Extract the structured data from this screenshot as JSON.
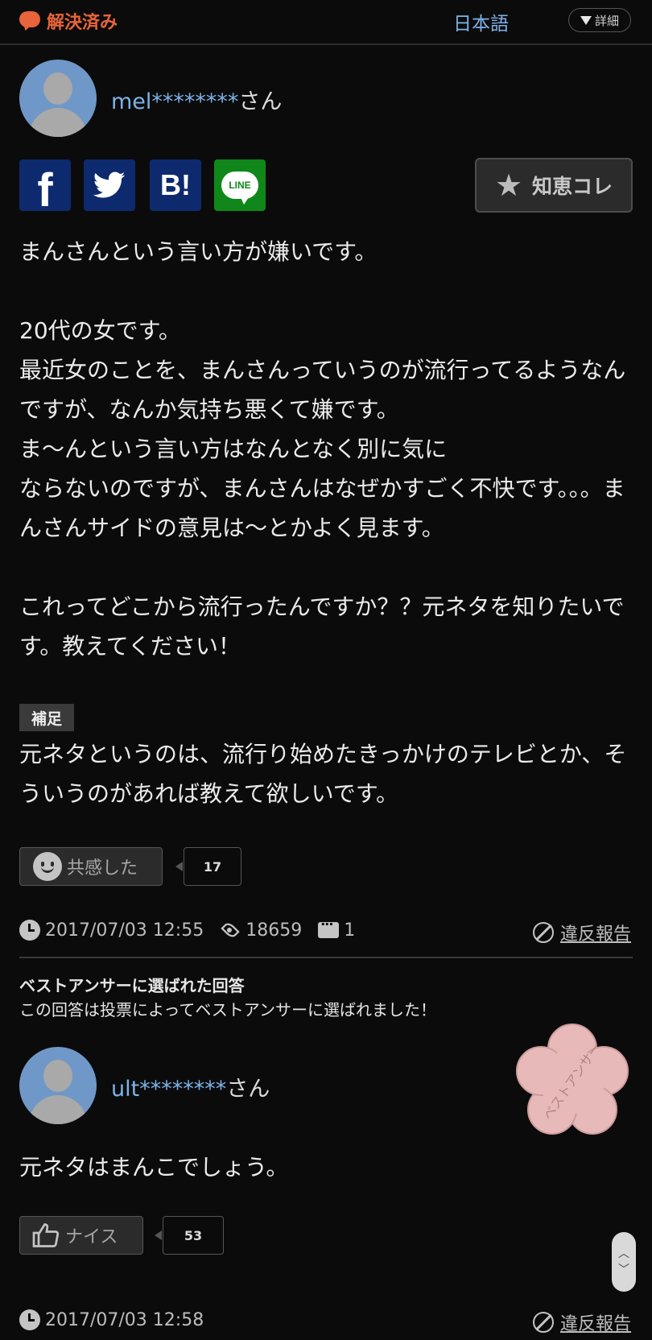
{
  "header": {
    "status": "解決済み",
    "language": "日本語",
    "details_label": "詳細"
  },
  "question": {
    "user_name": "mel********",
    "user_suffix": "さん",
    "share": {
      "facebook": "f",
      "twitter": "twitter-bird-icon",
      "hatena": "B!",
      "line": "LINE"
    },
    "chie_collection_label": "知恵コレ",
    "body": "まんさんという言い方が嫌いです。\n\n20代の女です。\n最近女のことを、まんさんっていうのが流行ってるようなんですが、なんか気持ち悪くて嫌です。\nま〜んという言い方はなんとなく別に気に\nならないのですが、まんさんはなぜかすごく不快です。。。まんさんサイドの意見は〜とかよく見ます。\n\nこれってどこから流行ったんですか？？元ネタを知りたいです。教えてください！",
    "supplement_tag": "補足",
    "supplement": "元ネタというのは、流行り始めたきっかけのテレビとか、そういうのがあれば教えて欲しいです。",
    "empathy_label": "共感した",
    "empathy_count": "17",
    "timestamp": "2017/07/03 12:55",
    "views": "18659",
    "answers": "1",
    "report_label": "違反報告"
  },
  "best_answer": {
    "title": "ベストアンサーに選ばれた回答",
    "subtitle": "この回答は投票によってベストアンサーに選ばれました！",
    "stamp_text": "ベストアンサー",
    "user_name": "ult********",
    "user_suffix": "さん",
    "body": "元ネタはまんこでしょう。",
    "nice_label": "ナイス",
    "nice_count": "53",
    "timestamp": "2017/07/03 12:58",
    "report_label": "違反報告"
  },
  "colors": {
    "accent_orange": "#e8643a",
    "link_blue": "#7db3ea",
    "line_green": "#10871a",
    "share_blue": "#0e2a6e",
    "stamp_pink": "#e7b9b9"
  }
}
